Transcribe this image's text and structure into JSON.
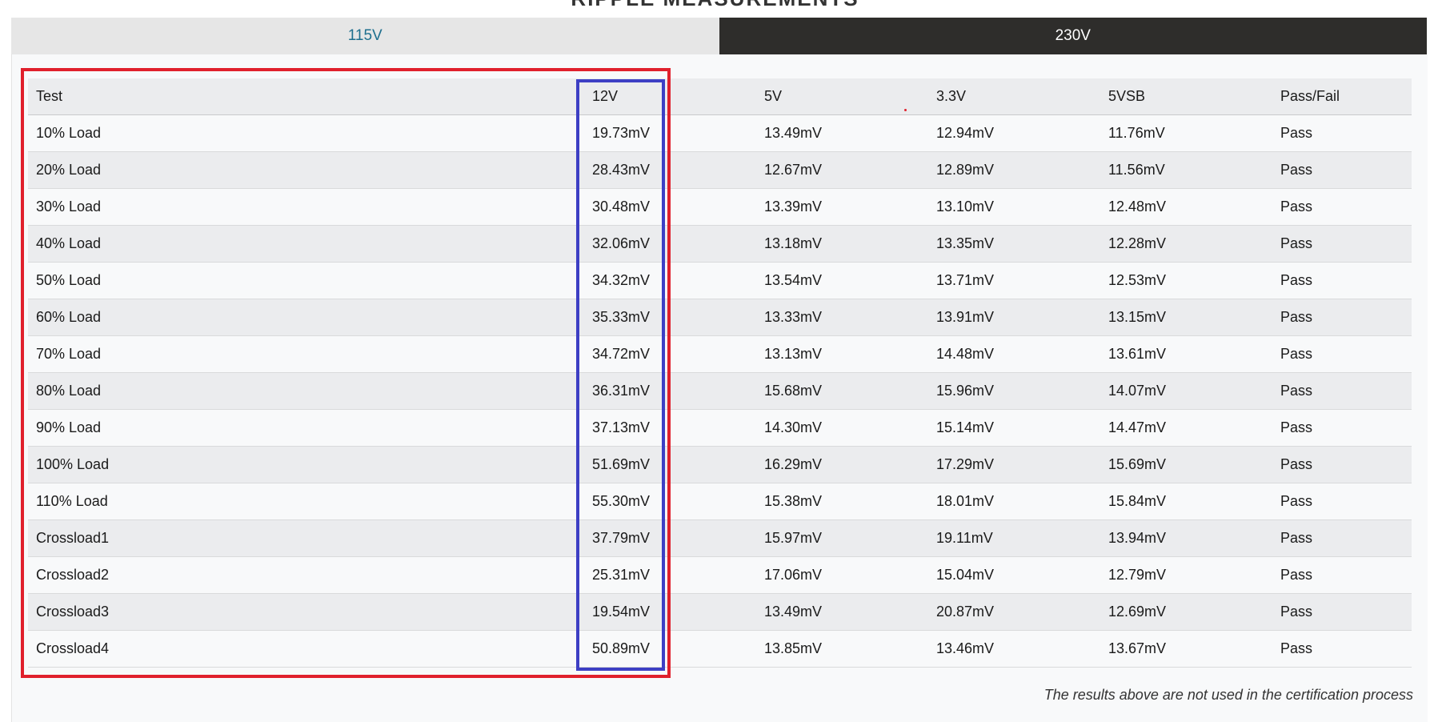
{
  "section": {
    "title": "RIPPLE MEASUREMENTS"
  },
  "tabs": [
    {
      "label": "115V",
      "active": false
    },
    {
      "label": "230V",
      "active": true
    }
  ],
  "table": {
    "headers": [
      "Test",
      "12V",
      "5V",
      "3.3V",
      "5VSB",
      "Pass/Fail"
    ],
    "rows": [
      [
        "10% Load",
        "19.73mV",
        "13.49mV",
        "12.94mV",
        "11.76mV",
        "Pass"
      ],
      [
        "20% Load",
        "28.43mV",
        "12.67mV",
        "12.89mV",
        "11.56mV",
        "Pass"
      ],
      [
        "30% Load",
        "30.48mV",
        "13.39mV",
        "13.10mV",
        "12.48mV",
        "Pass"
      ],
      [
        "40% Load",
        "32.06mV",
        "13.18mV",
        "13.35mV",
        "12.28mV",
        "Pass"
      ],
      [
        "50% Load",
        "34.32mV",
        "13.54mV",
        "13.71mV",
        "12.53mV",
        "Pass"
      ],
      [
        "60% Load",
        "35.33mV",
        "13.33mV",
        "13.91mV",
        "13.15mV",
        "Pass"
      ],
      [
        "70% Load",
        "34.72mV",
        "13.13mV",
        "14.48mV",
        "13.61mV",
        "Pass"
      ],
      [
        "80% Load",
        "36.31mV",
        "15.68mV",
        "15.96mV",
        "14.07mV",
        "Pass"
      ],
      [
        "90% Load",
        "37.13mV",
        "14.30mV",
        "15.14mV",
        "14.47mV",
        "Pass"
      ],
      [
        "100% Load",
        "51.69mV",
        "16.29mV",
        "17.29mV",
        "15.69mV",
        "Pass"
      ],
      [
        "110% Load",
        "55.30mV",
        "15.38mV",
        "18.01mV",
        "15.84mV",
        "Pass"
      ],
      [
        "Crossload1",
        "37.79mV",
        "15.97mV",
        "19.11mV",
        "13.94mV",
        "Pass"
      ],
      [
        "Crossload2",
        "25.31mV",
        "17.06mV",
        "15.04mV",
        "12.79mV",
        "Pass"
      ],
      [
        "Crossload3",
        "19.54mV",
        "13.49mV",
        "20.87mV",
        "12.69mV",
        "Pass"
      ],
      [
        "Crossload4",
        "50.89mV",
        "13.85mV",
        "13.46mV",
        "13.67mV",
        "Pass"
      ]
    ]
  },
  "footnote": "The results above are not used in the certification process",
  "colors": {
    "active_tab_bg": "#2e2d2b",
    "inactive_tab_text": "#1e6f8e",
    "highlight_red": "#e0202c",
    "highlight_blue": "#3d3fc4"
  }
}
